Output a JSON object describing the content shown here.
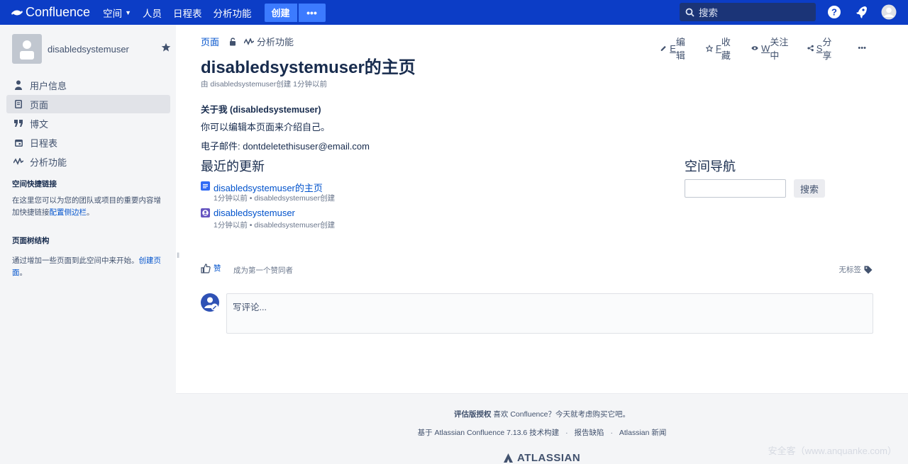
{
  "topnav": {
    "logo_text": "Confluence",
    "items": [
      "空间",
      "人员",
      "日程表",
      "分析功能"
    ],
    "create_label": "创建",
    "more_label": "•••",
    "search_placeholder": "搜索"
  },
  "sidebar": {
    "space_name": "disabledsystemuser",
    "nav": [
      {
        "label": "用户信息",
        "icon": "user-icon"
      },
      {
        "label": "页面",
        "icon": "page-icon",
        "active": true
      },
      {
        "label": "博文",
        "icon": "quote-icon"
      },
      {
        "label": "日程表",
        "icon": "calendar-icon"
      },
      {
        "label": "分析功能",
        "icon": "analytics-icon"
      }
    ],
    "shortcuts_title": "空间快捷链接",
    "shortcuts_text": "在这里您可以为您的团队或项目的重要内容增加快捷链接",
    "shortcuts_link": "配置侧边栏",
    "shortcuts_end": "。",
    "tree_title": "页面树结构",
    "tree_text": "通过增加一些页面到此空间中来开始。",
    "tree_link": "创建页面",
    "tree_end": "。"
  },
  "breadcrumbs": {
    "pages": "页面",
    "analytics": "分析功能"
  },
  "page_actions": {
    "edit_key": "E",
    "edit": "编辑",
    "save_key": "F",
    "save": "收藏",
    "watch_key": "W",
    "watch": "关注中",
    "share_key": "S",
    "share": "分享",
    "more": "•••"
  },
  "page": {
    "title": "disabledsystemuser的主页",
    "byline": "由 disabledsystemuser创建 1分钟以前",
    "about_heading": "关于我 (disabledsystemuser)",
    "about_text": "你可以编辑本页面来介绍自己。",
    "email": "电子邮件: dontdeletethisuser@email.com"
  },
  "recent": {
    "heading": "最近的更新",
    "items": [
      {
        "title": "disabledsystemuser的主页",
        "meta": "1分钟以前 • disabledsystemuser创建",
        "icon": "page-icon"
      },
      {
        "title": "disabledsystemuser",
        "meta": "1分钟以前 • disabledsystemuser创建",
        "icon": "user-profile-icon"
      }
    ]
  },
  "space_nav": {
    "heading": "空间导航",
    "search_button": "搜索"
  },
  "likes": {
    "like_label": "赞",
    "first_like": "成为第一个赞同者",
    "no_labels": "无标签"
  },
  "comment": {
    "placeholder": "写评论..."
  },
  "footer": {
    "eval_bold": "评估版授权",
    "eval_text": " 喜欢 Confluence？今天就考虑购买它吧。",
    "powered": "基于 Atlassian Confluence 7.13.6 技术构建",
    "report": "报告缺陷",
    "news": "Atlassian 新闻",
    "sep": "·",
    "logo": "ATLASSIAN"
  },
  "watermark": "安全客（www.anquanke.com）",
  "colors": {
    "nav_bg": "#0c3dc6",
    "create_btn": "#3c7bff",
    "link": "#0052cc",
    "sidebar_bg": "#f4f5f7"
  }
}
